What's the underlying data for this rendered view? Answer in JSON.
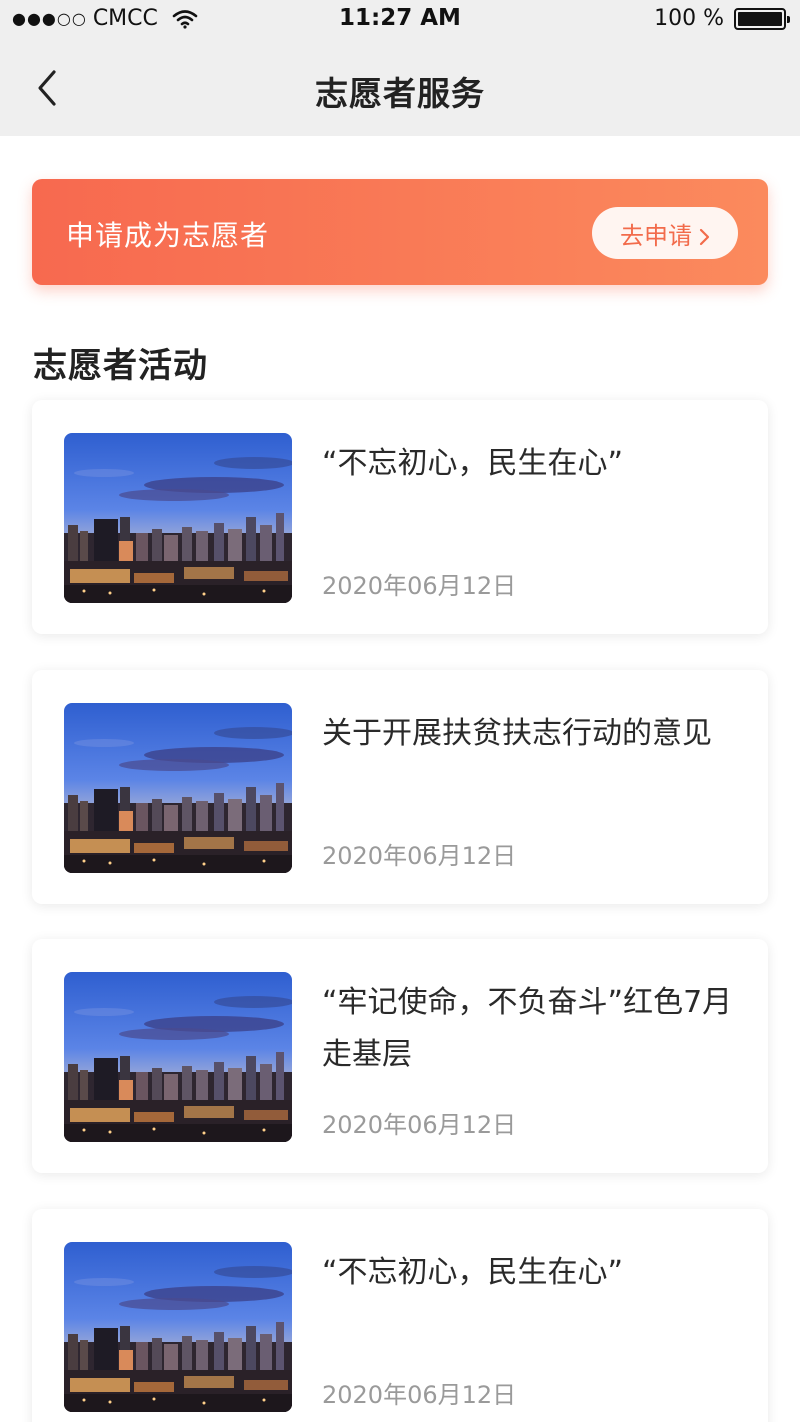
{
  "status_bar": {
    "signal": "●●●○○",
    "carrier": "CMCC",
    "time": "11:27 AM",
    "battery": "100 %"
  },
  "nav": {
    "title": "志愿者服务"
  },
  "banner": {
    "text": "申请成为志愿者",
    "button_label": "去申请"
  },
  "section": {
    "title": "志愿者活动"
  },
  "activities": [
    {
      "title": "“不忘初心，民生在心”",
      "date": "2020年06月12日"
    },
    {
      "title": "关于开展扶贫扶志行动的意见",
      "date": "2020年06月12日"
    },
    {
      "title": "“牢记使命，不负奋斗”红色7月走基层",
      "date": "2020年06月12日"
    },
    {
      "title": "“不忘初心，民生在心”",
      "date": "2020年06月12日"
    }
  ],
  "colors": {
    "banner_start": "#f7694f",
    "banner_end": "#fb8a5d",
    "button_text": "#f26b4b",
    "date_text": "#9a9a9a"
  },
  "icons": [
    "back-chevron-icon",
    "wifi-icon",
    "battery-icon",
    "chevron-right-icon"
  ]
}
